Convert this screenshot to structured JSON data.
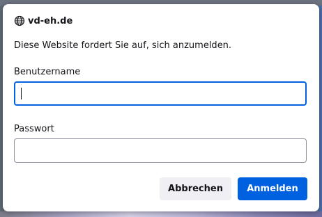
{
  "dialog": {
    "site": "vd-eh.de",
    "site_icon": "globe-icon",
    "message": "Diese Website fordert Sie auf, sich anzumelden.",
    "username": {
      "label": "Benutzername",
      "value": ""
    },
    "password": {
      "label": "Passwort",
      "value": ""
    },
    "buttons": {
      "cancel": "Abbrechen",
      "login": "Anmelden"
    }
  },
  "colors": {
    "accent": "#0061e0",
    "secondary_button": "#f0f0f4",
    "text": "#15141a"
  }
}
